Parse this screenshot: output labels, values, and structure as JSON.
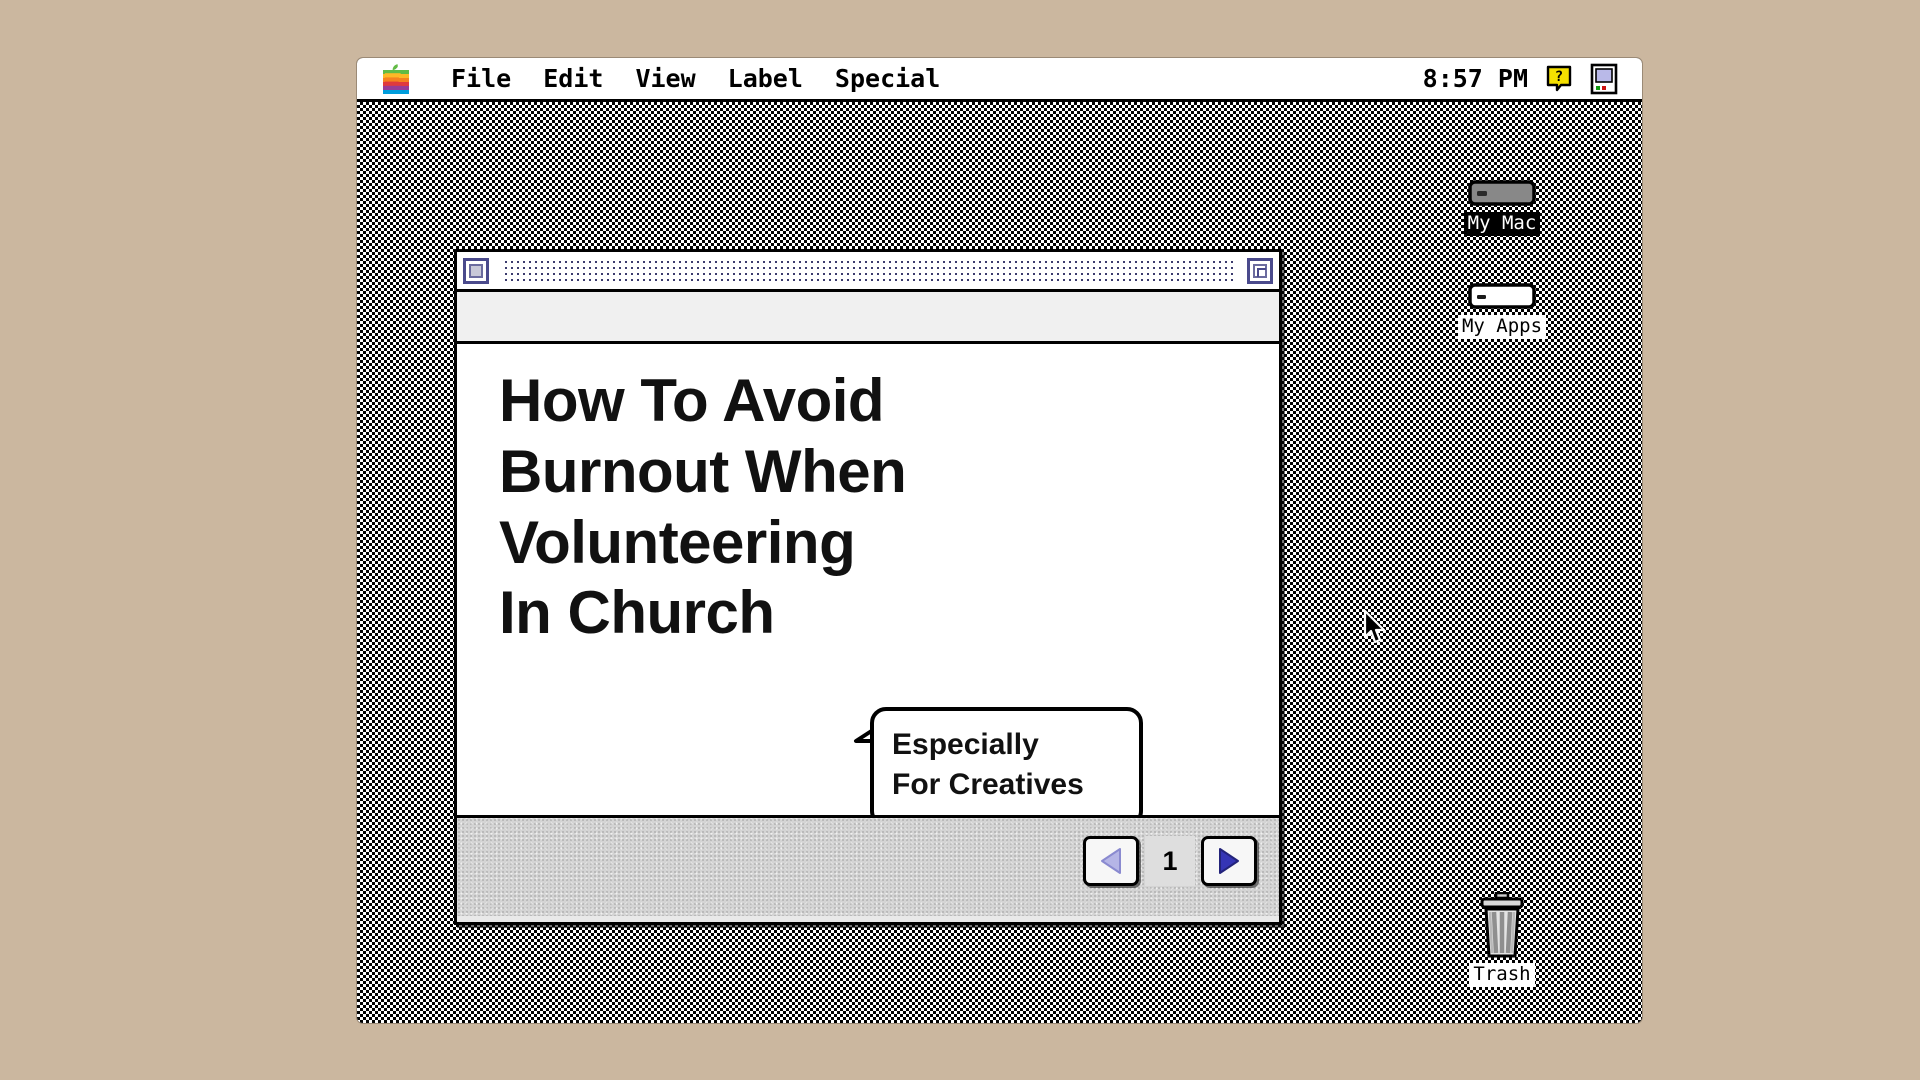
{
  "menubar": {
    "apple_icon": "apple-logo-rainbow",
    "items": [
      {
        "label": "File"
      },
      {
        "label": "Edit"
      },
      {
        "label": "View"
      },
      {
        "label": "Label"
      },
      {
        "label": "Special"
      }
    ],
    "clock": "8:57 PM",
    "help_icon": "help-question-balloon-icon",
    "app_switcher_icon": "application-switcher-mac-icon"
  },
  "window": {
    "close_box": "close-box",
    "zoom_box": "zoom-box",
    "title": "",
    "content": {
      "headline_lines": [
        "How To Avoid",
        "Burnout When",
        "Volunteering",
        "In Church"
      ],
      "bubble": {
        "line1": "Especially",
        "line2": "For Creatives"
      }
    },
    "pager": {
      "prev_icon": "triangle-left-icon",
      "page_number": "1",
      "next_icon": "triangle-right-icon",
      "prev_enabled": false,
      "next_enabled": true
    }
  },
  "desktop": {
    "icons": [
      {
        "label": "My Mac",
        "icon": "hard-drive-icon",
        "selected": true
      },
      {
        "label": "My Apps",
        "icon": "hard-drive-icon",
        "selected": false
      },
      {
        "label": "Trash",
        "icon": "trash-can-icon",
        "selected": false
      }
    ],
    "cursor_icon": "arrow-pointer-cursor"
  },
  "colors": {
    "bezel": "#cbb79f",
    "menubar_bg": "#ffffff",
    "window_bg": "#e9e9e9",
    "content_bg": "#ffffff",
    "accent_blue": "#4a4a8c",
    "arrow_active": "#3b3bb0",
    "arrow_disabled": "#aaaae0"
  }
}
